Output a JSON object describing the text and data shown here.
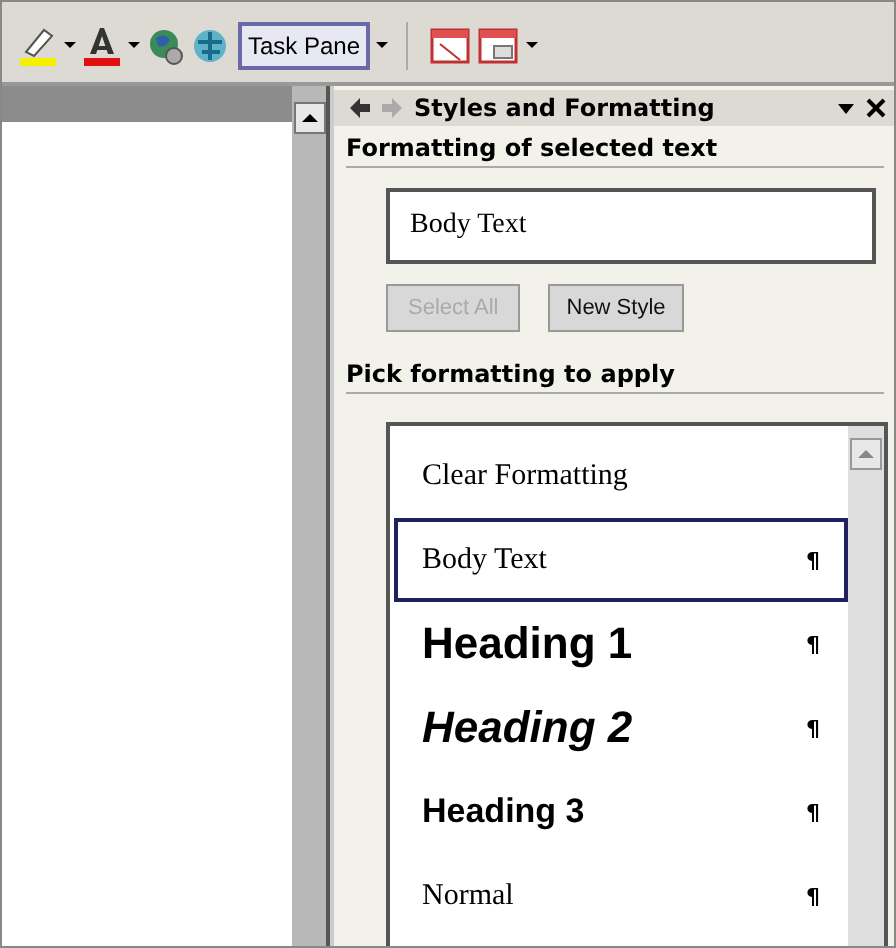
{
  "toolbar": {
    "task_pane_button": "Task Pane"
  },
  "task_pane": {
    "title": "Styles and Formatting",
    "back_enabled": true,
    "forward_enabled": false,
    "selected_section": {
      "heading": "Formatting of selected text",
      "current_style": "Body Text",
      "buttons": [
        {
          "label": "Select All",
          "disabled": true
        },
        {
          "label": "New Style",
          "disabled": false
        }
      ]
    },
    "pick_section": {
      "heading": "Pick formatting to apply",
      "styles": [
        {
          "label": "Clear Formatting",
          "kind": "plain",
          "selected": false
        },
        {
          "label": "Body Text",
          "kind": "plain",
          "mark": "¶",
          "selected": true
        },
        {
          "label": "Heading 1",
          "kind": "heading1",
          "mark": "¶",
          "selected": false
        },
        {
          "label": "Heading 2",
          "kind": "heading2",
          "mark": "¶",
          "selected": false
        },
        {
          "label": "Heading 3",
          "kind": "heading3",
          "mark": "¶",
          "selected": false
        },
        {
          "label": "Normal",
          "kind": "plain",
          "mark": "¶",
          "selected": false
        }
      ]
    }
  }
}
